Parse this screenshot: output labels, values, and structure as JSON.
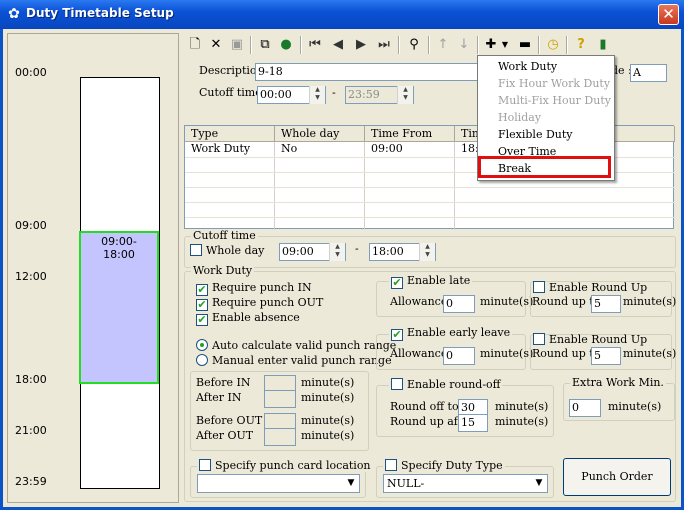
{
  "window": {
    "title": "Duty Timetable Setup",
    "icon": "gear-icon",
    "close_label": "✕"
  },
  "timeline": {
    "labels": [
      "00:00",
      "09:00",
      "12:00",
      "18:00",
      "21:00",
      "23:59"
    ],
    "block_start": "09:00-",
    "block_end": "18:00",
    "block_color": "#c4c4ff",
    "block_border": "#22dd22"
  },
  "toolbar": {
    "icons": [
      "new-icon",
      "delete-icon",
      "save-icon",
      "copy-icon",
      "globe-icon",
      "first-record-icon",
      "previous-record-icon",
      "next-record-icon",
      "last-record-icon",
      "find-icon",
      "move-up-icon",
      "move-down-icon",
      "add-icon",
      "add-dropdown-icon",
      "remove-icon",
      "clock-icon",
      "help-icon",
      "exit-icon"
    ]
  },
  "header": {
    "description_label": "Description",
    "description_value": "9-18",
    "cutoff_label": "Cutoff time",
    "cutoff_from": "00:00",
    "cutoff_to": "23:59",
    "cutoff_dash": "-",
    "code_label": "de :",
    "code_value": "A"
  },
  "grid": {
    "columns": [
      "Type",
      "Whole day",
      "Time From",
      "Time"
    ],
    "rows": [
      [
        "Work Duty",
        "No",
        "09:00",
        "18:0"
      ]
    ]
  },
  "add_menu": {
    "items": [
      {
        "label": "Work Duty",
        "enabled": true
      },
      {
        "label": "Fix Hour Work Duty",
        "enabled": false
      },
      {
        "label": "Multi-Fix Hour Duty",
        "enabled": false
      },
      {
        "label": "Holiday",
        "enabled": false
      },
      {
        "label": "Flexible Duty",
        "enabled": true
      },
      {
        "label": "Over Time",
        "enabled": true
      },
      {
        "label": "Break",
        "enabled": true
      }
    ],
    "highlight_color": "#e01010"
  },
  "cutoff_section": {
    "title": "Cutoff time",
    "whole_day_label": "Whole day",
    "whole_day_checked": false,
    "from": "09:00",
    "to": "18:00",
    "dash": "-"
  },
  "work_duty": {
    "title": "Work Duty",
    "require_in_label": "Require punch IN",
    "require_in_checked": true,
    "require_out_label": "Require punch OUT",
    "require_out_checked": true,
    "enable_absence_label": "Enable absence",
    "enable_absence_checked": true,
    "auto_calc_label": "Auto calculate valid punch range",
    "manual_label": "Manual enter valid punch range",
    "selected_range_mode": "Auto calculate valid punch range",
    "before_in_label": "Before IN",
    "after_in_label": "After IN",
    "before_out_label": "Before OUT",
    "after_out_label": "After OUT",
    "minutes_label": "minute(s)"
  },
  "late": {
    "enable_label": "Enable late",
    "enabled": true,
    "allowance_label": "Allowance",
    "allowance_value": "0",
    "minutes_label": "minute(s)",
    "round_up_label": "Enable Round Up",
    "round_up_checked": false,
    "round_up_to_label": "Round up to",
    "round_up_to_value": "5"
  },
  "early_leave": {
    "enable_label": "Enable early leave",
    "enabled": true,
    "allowance_label": "Allowance",
    "allowance_value": "0",
    "minutes_label": "minute(s)",
    "round_up_label": "Enable Round Up",
    "round_up_checked": false,
    "round_up_to_label": "Round up to",
    "round_up_to_value": "5"
  },
  "round_off": {
    "enable_label": "Enable round-off",
    "enabled": false,
    "round_off_to_label": "Round off to",
    "round_off_to_value": "30",
    "round_up_after_label": "Round up after",
    "round_up_after_value": "15",
    "minutes_label": "minute(s)"
  },
  "extra_work": {
    "title": "Extra Work Min.",
    "value": "0",
    "minutes_label": "minute(s)"
  },
  "punch_location": {
    "label": "Specify punch card location",
    "checked": false,
    "value": ""
  },
  "duty_type": {
    "label": "Specify Duty Type",
    "checked": false,
    "value": "NULL-"
  },
  "punch_order": {
    "label": "Punch Order"
  }
}
